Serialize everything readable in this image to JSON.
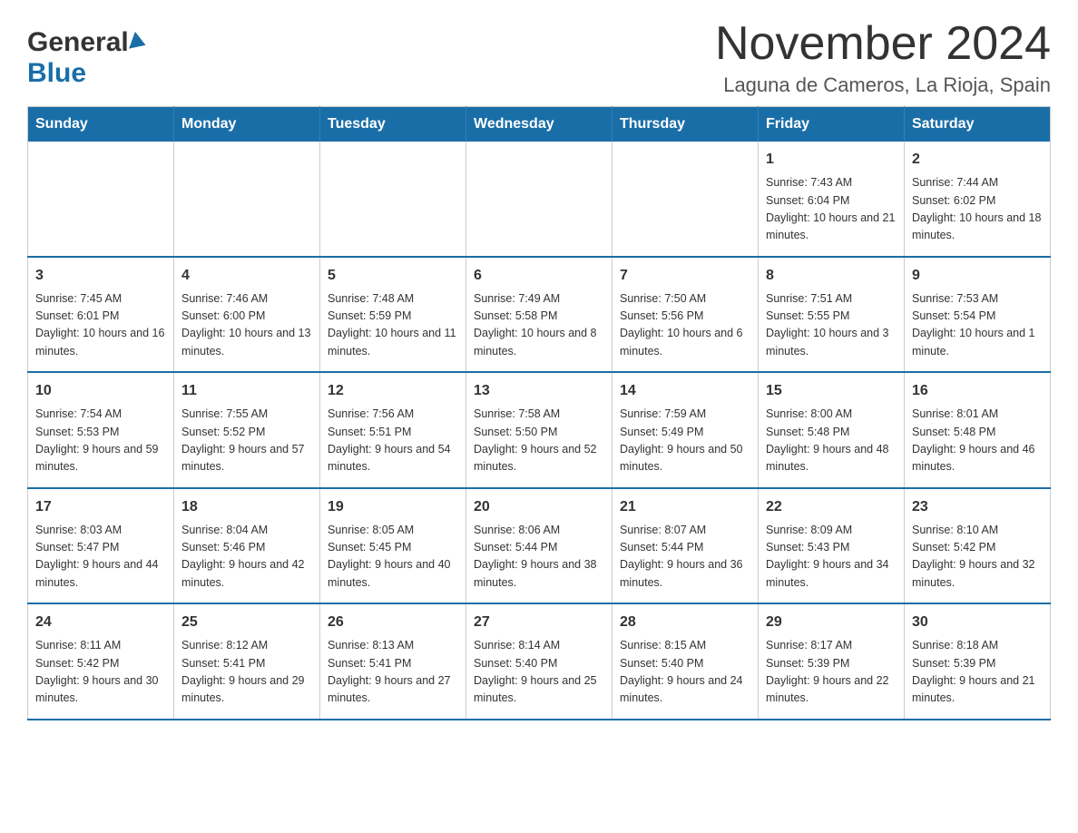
{
  "header": {
    "logo_general": "General",
    "logo_blue": "Blue",
    "month_title": "November 2024",
    "location": "Laguna de Cameros, La Rioja, Spain"
  },
  "days_of_week": [
    "Sunday",
    "Monday",
    "Tuesday",
    "Wednesday",
    "Thursday",
    "Friday",
    "Saturday"
  ],
  "weeks": [
    [
      {
        "day": "",
        "sunrise": "",
        "sunset": "",
        "daylight": ""
      },
      {
        "day": "",
        "sunrise": "",
        "sunset": "",
        "daylight": ""
      },
      {
        "day": "",
        "sunrise": "",
        "sunset": "",
        "daylight": ""
      },
      {
        "day": "",
        "sunrise": "",
        "sunset": "",
        "daylight": ""
      },
      {
        "day": "",
        "sunrise": "",
        "sunset": "",
        "daylight": ""
      },
      {
        "day": "1",
        "sunrise": "Sunrise: 7:43 AM",
        "sunset": "Sunset: 6:04 PM",
        "daylight": "Daylight: 10 hours and 21 minutes."
      },
      {
        "day": "2",
        "sunrise": "Sunrise: 7:44 AM",
        "sunset": "Sunset: 6:02 PM",
        "daylight": "Daylight: 10 hours and 18 minutes."
      }
    ],
    [
      {
        "day": "3",
        "sunrise": "Sunrise: 7:45 AM",
        "sunset": "Sunset: 6:01 PM",
        "daylight": "Daylight: 10 hours and 16 minutes."
      },
      {
        "day": "4",
        "sunrise": "Sunrise: 7:46 AM",
        "sunset": "Sunset: 6:00 PM",
        "daylight": "Daylight: 10 hours and 13 minutes."
      },
      {
        "day": "5",
        "sunrise": "Sunrise: 7:48 AM",
        "sunset": "Sunset: 5:59 PM",
        "daylight": "Daylight: 10 hours and 11 minutes."
      },
      {
        "day": "6",
        "sunrise": "Sunrise: 7:49 AM",
        "sunset": "Sunset: 5:58 PM",
        "daylight": "Daylight: 10 hours and 8 minutes."
      },
      {
        "day": "7",
        "sunrise": "Sunrise: 7:50 AM",
        "sunset": "Sunset: 5:56 PM",
        "daylight": "Daylight: 10 hours and 6 minutes."
      },
      {
        "day": "8",
        "sunrise": "Sunrise: 7:51 AM",
        "sunset": "Sunset: 5:55 PM",
        "daylight": "Daylight: 10 hours and 3 minutes."
      },
      {
        "day": "9",
        "sunrise": "Sunrise: 7:53 AM",
        "sunset": "Sunset: 5:54 PM",
        "daylight": "Daylight: 10 hours and 1 minute."
      }
    ],
    [
      {
        "day": "10",
        "sunrise": "Sunrise: 7:54 AM",
        "sunset": "Sunset: 5:53 PM",
        "daylight": "Daylight: 9 hours and 59 minutes."
      },
      {
        "day": "11",
        "sunrise": "Sunrise: 7:55 AM",
        "sunset": "Sunset: 5:52 PM",
        "daylight": "Daylight: 9 hours and 57 minutes."
      },
      {
        "day": "12",
        "sunrise": "Sunrise: 7:56 AM",
        "sunset": "Sunset: 5:51 PM",
        "daylight": "Daylight: 9 hours and 54 minutes."
      },
      {
        "day": "13",
        "sunrise": "Sunrise: 7:58 AM",
        "sunset": "Sunset: 5:50 PM",
        "daylight": "Daylight: 9 hours and 52 minutes."
      },
      {
        "day": "14",
        "sunrise": "Sunrise: 7:59 AM",
        "sunset": "Sunset: 5:49 PM",
        "daylight": "Daylight: 9 hours and 50 minutes."
      },
      {
        "day": "15",
        "sunrise": "Sunrise: 8:00 AM",
        "sunset": "Sunset: 5:48 PM",
        "daylight": "Daylight: 9 hours and 48 minutes."
      },
      {
        "day": "16",
        "sunrise": "Sunrise: 8:01 AM",
        "sunset": "Sunset: 5:48 PM",
        "daylight": "Daylight: 9 hours and 46 minutes."
      }
    ],
    [
      {
        "day": "17",
        "sunrise": "Sunrise: 8:03 AM",
        "sunset": "Sunset: 5:47 PM",
        "daylight": "Daylight: 9 hours and 44 minutes."
      },
      {
        "day": "18",
        "sunrise": "Sunrise: 8:04 AM",
        "sunset": "Sunset: 5:46 PM",
        "daylight": "Daylight: 9 hours and 42 minutes."
      },
      {
        "day": "19",
        "sunrise": "Sunrise: 8:05 AM",
        "sunset": "Sunset: 5:45 PM",
        "daylight": "Daylight: 9 hours and 40 minutes."
      },
      {
        "day": "20",
        "sunrise": "Sunrise: 8:06 AM",
        "sunset": "Sunset: 5:44 PM",
        "daylight": "Daylight: 9 hours and 38 minutes."
      },
      {
        "day": "21",
        "sunrise": "Sunrise: 8:07 AM",
        "sunset": "Sunset: 5:44 PM",
        "daylight": "Daylight: 9 hours and 36 minutes."
      },
      {
        "day": "22",
        "sunrise": "Sunrise: 8:09 AM",
        "sunset": "Sunset: 5:43 PM",
        "daylight": "Daylight: 9 hours and 34 minutes."
      },
      {
        "day": "23",
        "sunrise": "Sunrise: 8:10 AM",
        "sunset": "Sunset: 5:42 PM",
        "daylight": "Daylight: 9 hours and 32 minutes."
      }
    ],
    [
      {
        "day": "24",
        "sunrise": "Sunrise: 8:11 AM",
        "sunset": "Sunset: 5:42 PM",
        "daylight": "Daylight: 9 hours and 30 minutes."
      },
      {
        "day": "25",
        "sunrise": "Sunrise: 8:12 AM",
        "sunset": "Sunset: 5:41 PM",
        "daylight": "Daylight: 9 hours and 29 minutes."
      },
      {
        "day": "26",
        "sunrise": "Sunrise: 8:13 AM",
        "sunset": "Sunset: 5:41 PM",
        "daylight": "Daylight: 9 hours and 27 minutes."
      },
      {
        "day": "27",
        "sunrise": "Sunrise: 8:14 AM",
        "sunset": "Sunset: 5:40 PM",
        "daylight": "Daylight: 9 hours and 25 minutes."
      },
      {
        "day": "28",
        "sunrise": "Sunrise: 8:15 AM",
        "sunset": "Sunset: 5:40 PM",
        "daylight": "Daylight: 9 hours and 24 minutes."
      },
      {
        "day": "29",
        "sunrise": "Sunrise: 8:17 AM",
        "sunset": "Sunset: 5:39 PM",
        "daylight": "Daylight: 9 hours and 22 minutes."
      },
      {
        "day": "30",
        "sunrise": "Sunrise: 8:18 AM",
        "sunset": "Sunset: 5:39 PM",
        "daylight": "Daylight: 9 hours and 21 minutes."
      }
    ]
  ]
}
